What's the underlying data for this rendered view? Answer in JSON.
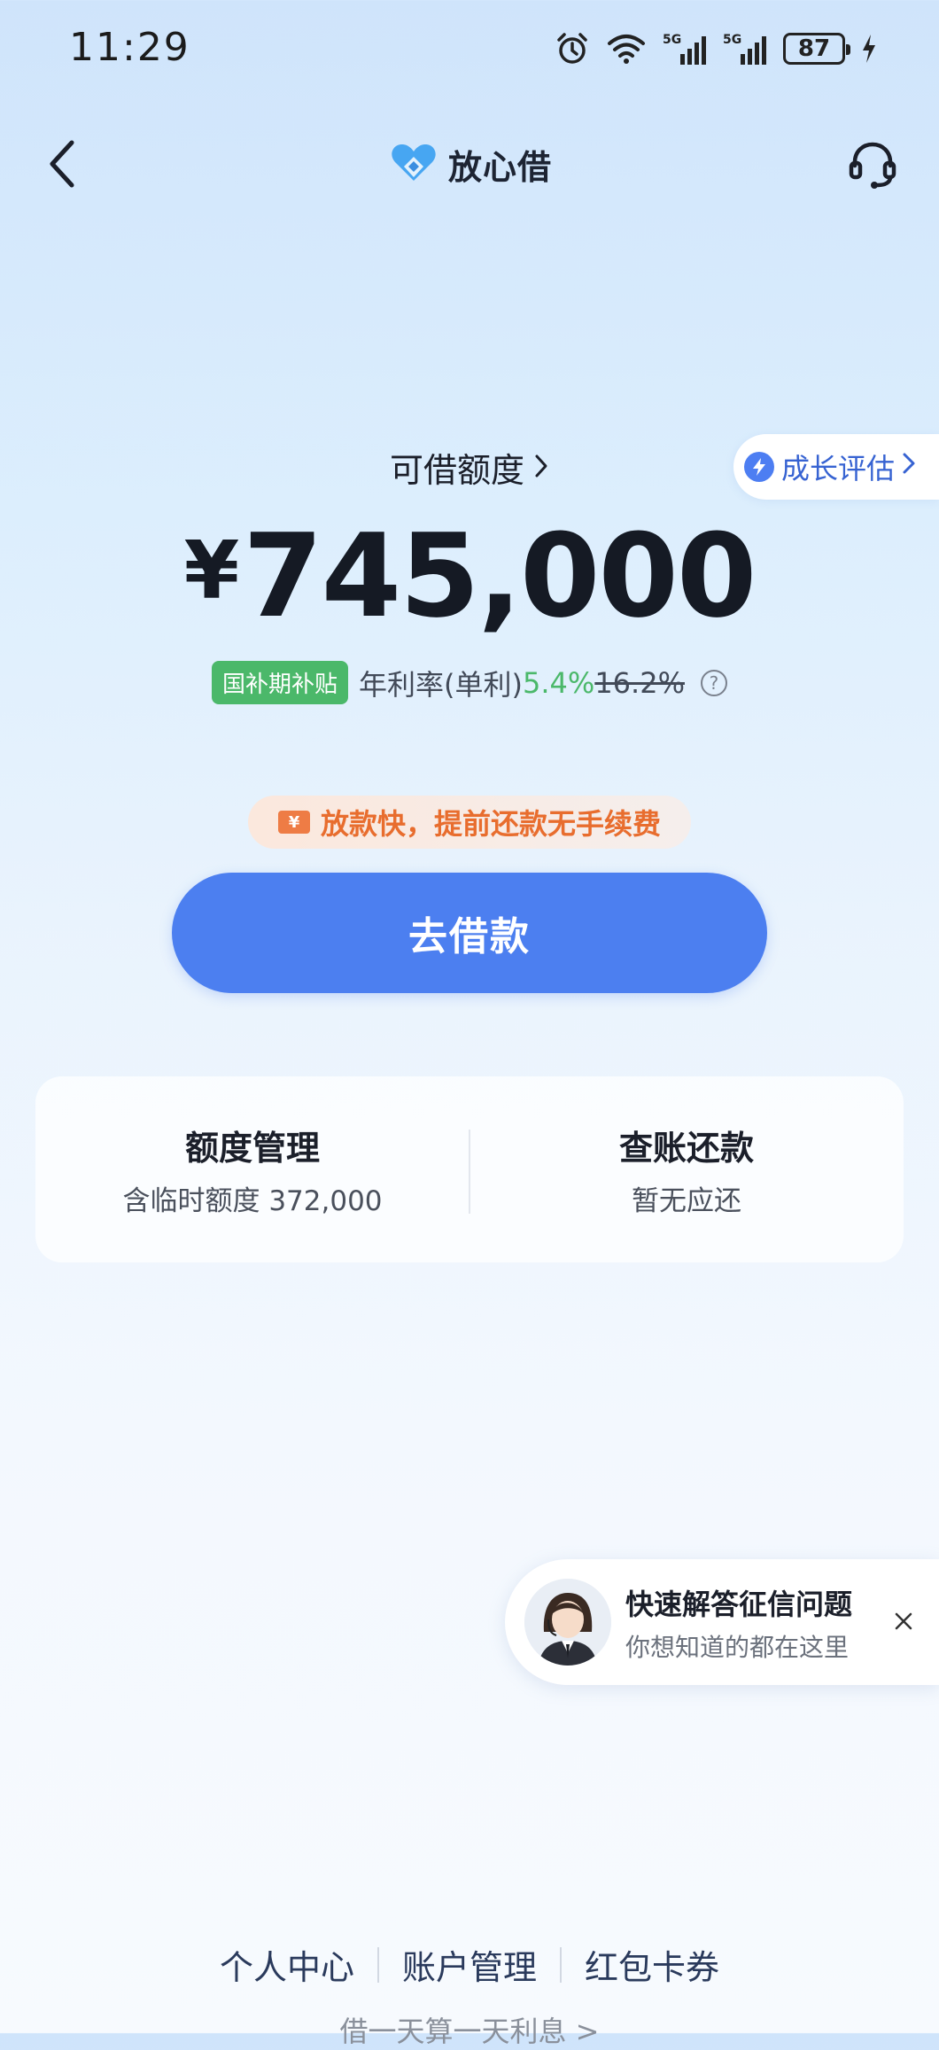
{
  "status_bar": {
    "time": "11:29",
    "battery": "87",
    "network_1": "5G",
    "network_2": "5G"
  },
  "header": {
    "brand": "放心借"
  },
  "growth": {
    "label": "成长评估"
  },
  "credit": {
    "title": "可借额度",
    "currency": "¥",
    "amount": "745,000",
    "subsidy_badge": "国补期补贴",
    "rate_label": "年利率(单利)",
    "rate_current": "5.4%",
    "rate_original": "16.2%"
  },
  "promo": {
    "icon": "¥",
    "text": "放款快，提前还款无手续费"
  },
  "borrow_button": {
    "label": "去借款"
  },
  "info_card": {
    "left_title": "额度管理",
    "left_sub": "含临时额度 372,000",
    "right_title": "查账还款",
    "right_sub": "暂无应还"
  },
  "help_card": {
    "title": "快速解答征信问题",
    "subtitle": "你想知道的都在这里"
  },
  "bottom": {
    "links": [
      "个人中心",
      "账户管理",
      "红包卡券"
    ],
    "note": "借一天算一天利息 >"
  },
  "colors": {
    "accent": "#4c7ff0",
    "green": "#4bb86a",
    "orange": "#e86d2e"
  },
  "icons": [
    "alarm-icon",
    "wifi-icon",
    "signal-icon",
    "battery-icon",
    "charging-icon",
    "back-icon",
    "brand-logo-icon",
    "headset-icon",
    "growth-icon",
    "chevron-right-icon",
    "help-circle-icon",
    "coupon-icon",
    "close-icon"
  ]
}
